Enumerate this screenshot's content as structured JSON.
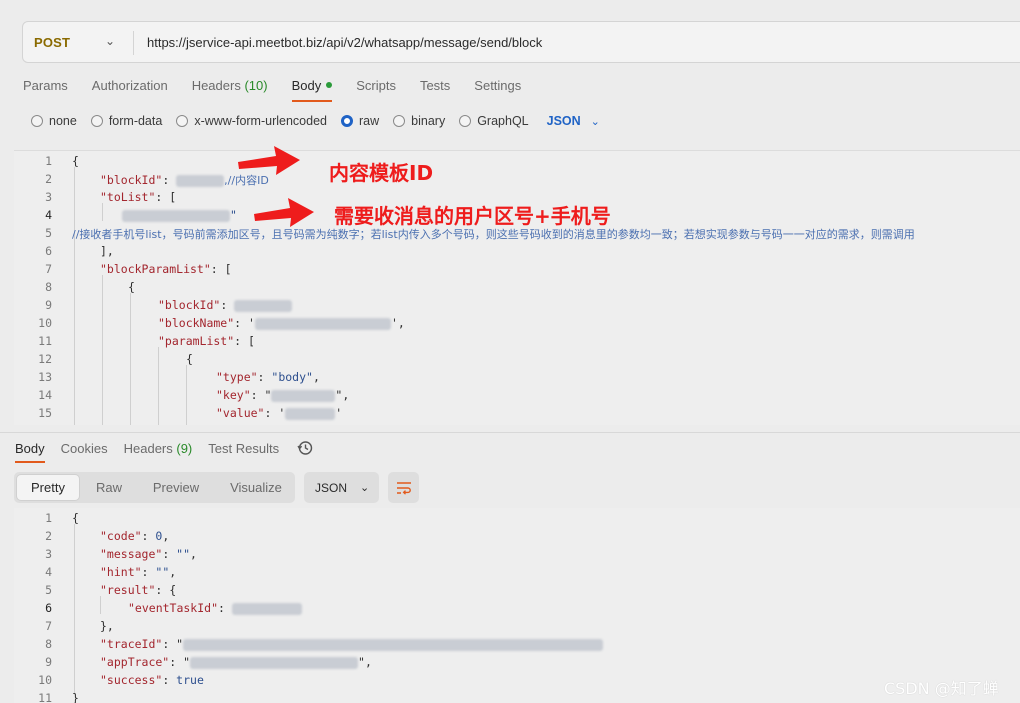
{
  "request": {
    "method": "POST",
    "url": "https://jservice-api.meetbot.biz/api/v2/whatsapp/message/send/block"
  },
  "tabs": {
    "params": "Params",
    "authorization": "Authorization",
    "headers_label": "Headers",
    "headers_count": "(10)",
    "body": "Body",
    "scripts": "Scripts",
    "tests": "Tests",
    "settings": "Settings"
  },
  "body_types": {
    "none": "none",
    "form_data": "form-data",
    "urlencoded": "x-www-form-urlencoded",
    "raw": "raw",
    "binary": "binary",
    "graphql": "GraphQL",
    "format": "JSON"
  },
  "request_body": {
    "line_numbers": [
      "1",
      "2",
      "3",
      "4",
      "5",
      "6",
      "7",
      "8",
      "9",
      "10",
      "11",
      "12",
      "13",
      "14",
      "15"
    ],
    "l1": "{",
    "l2_key": "\"blockId\"",
    "l2_comment": ",//内容ID",
    "l3_key": "\"toList\"",
    "l3_rest": ": [",
    "l4_tail": "\"",
    "l5_comment": "//接收者手机号list，号码前需添加区号，且号码需为纯数字；若list内传入多个号码，则这些号码收到的消息里的参数均一致；若想实现参数与号码一一对应的需求，则需调用",
    "l6": "],",
    "l7_key": "\"blockParamList\"",
    "l7_rest": ": [",
    "l8": "{",
    "l9_key": "\"blockId\"",
    "l10_key": "\"blockName\"",
    "l10_open": ": '",
    "l10_close": "',",
    "l11_key": "\"paramList\"",
    "l11_rest": ": [",
    "l12": "{",
    "l13_key": "\"type\"",
    "l13_val": "\"body\"",
    "l14_key": "\"key\"",
    "l14_open": ": \"",
    "l14_close": "\",",
    "l15_key": "\"value\"",
    "l15_open": ": '",
    "l15_close": "'"
  },
  "annotations": {
    "template_id": "内容模板ID",
    "phone": "需要收消息的用户区号+手机号"
  },
  "response_tabs": {
    "body": "Body",
    "cookies": "Cookies",
    "headers_label": "Headers",
    "headers_count": "(9)",
    "test_results": "Test Results"
  },
  "view_modes": {
    "pretty": "Pretty",
    "raw": "Raw",
    "preview": "Preview",
    "visualize": "Visualize",
    "format": "JSON"
  },
  "response_body": {
    "line_numbers": [
      "1",
      "2",
      "3",
      "4",
      "5",
      "6",
      "7",
      "8",
      "9",
      "10",
      "11"
    ],
    "l1": "{",
    "l2_key": "\"code\"",
    "l2_val": "0",
    "l3_key": "\"message\"",
    "l3_val": "\"\"",
    "l4_key": "\"hint\"",
    "l4_val": "\"\"",
    "l5_key": "\"result\"",
    "l5_rest": ": {",
    "l6_key": "\"eventTaskId\"",
    "l7": "},",
    "l8_key": "\"traceId\"",
    "l8_open": ": \"",
    "l9_key": "\"appTrace\"",
    "l9_open": ": \"",
    "l9_close": "\",",
    "l10_key": "\"success\"",
    "l10_val": "true",
    "l11": "}"
  },
  "watermark": "CSDN @知了蝉",
  "colors": {
    "accent": "#e25a1c",
    "raw_selected": "#1f63c6",
    "annotation": "#ee1c1c",
    "method": "#8a6a00"
  },
  "icons": [
    "chevron-down-icon",
    "radio-icon",
    "history-icon",
    "wrap-lines-icon",
    "annotation-arrow"
  ]
}
